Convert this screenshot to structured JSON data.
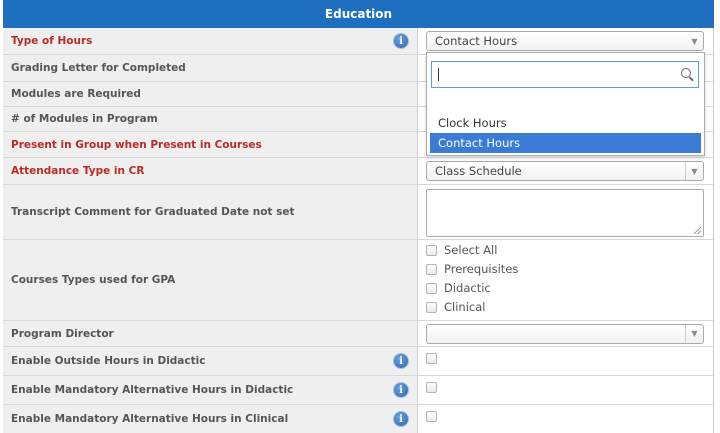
{
  "header": {
    "title": "Education"
  },
  "rows": {
    "type_of_hours": {
      "label": "Type of Hours",
      "value": "Contact Hours"
    },
    "grading_letter": {
      "label": "Grading Letter for Completed"
    },
    "modules_required": {
      "label": "Modules are Required"
    },
    "num_modules": {
      "label": "# of Modules in Program"
    },
    "present_group": {
      "label": "Present in Group when Present in Courses"
    },
    "attendance_type": {
      "label": "Attendance Type in CR",
      "value": "Class Schedule"
    },
    "transcript_comment": {
      "label": "Transcript Comment for Graduated Date not set",
      "value": ""
    },
    "courses_types": {
      "label": "Courses Types used for GPA",
      "options": [
        "Select All",
        "Prerequisites",
        "Didactic",
        "Clinical"
      ]
    },
    "program_director": {
      "label": "Program Director",
      "value": ""
    },
    "outside_hours": {
      "label": "Enable Outside Hours in Didactic"
    },
    "mand_alt_didactic": {
      "label": "Enable Mandatory Alternative Hours in Didactic"
    },
    "mand_alt_clinical": {
      "label": "Enable Mandatory Alternative Hours in Clinical"
    }
  },
  "dropdown": {
    "search_value": "",
    "options": [
      "Clock Hours",
      "Contact Hours"
    ],
    "selected": "Contact Hours"
  },
  "icons": {
    "info": "info-icon",
    "search": "search-icon",
    "select_arrow": "chevron-down-icon"
  },
  "info_glyph": "i",
  "arrow_glyph": "▼",
  "colors": {
    "header_bg": "#1e6fc0",
    "required_label": "#b92b27",
    "selected_option_bg": "#3a7bd5"
  }
}
